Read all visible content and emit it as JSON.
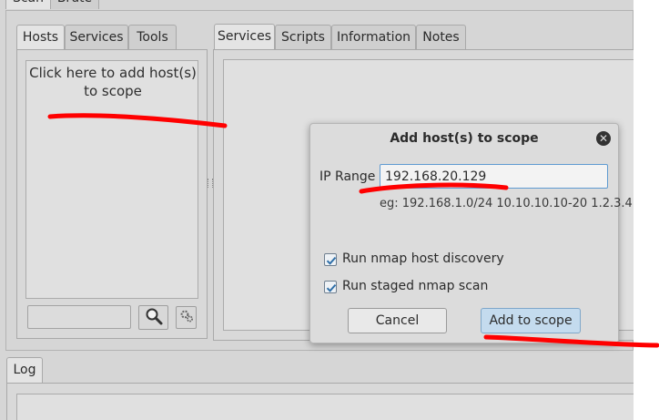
{
  "top_tabs": [
    "Scan",
    "Brute"
  ],
  "left_tabs": [
    "Hosts",
    "Services",
    "Tools"
  ],
  "right_tabs": [
    "Services",
    "Scripts",
    "Information",
    "Notes"
  ],
  "hosts_panel": {
    "hint": "Click here to add host(s) to scope",
    "filter_value": ""
  },
  "icons": {
    "search": "magnifier-icon",
    "settings": "gears-icon",
    "close": "close-icon",
    "check": "checkmark-icon"
  },
  "dialog": {
    "title": "Add host(s) to scope",
    "close_glyph": "✕",
    "ip_label": "IP Range",
    "ip_value": "192.168.20.129",
    "example": "eg: 192.168.1.0/24 10.10.10.10-20 1.2.3.4",
    "check_discovery": "Run nmap host discovery",
    "check_staged": "Run staged nmap scan",
    "discovery_checked": true,
    "staged_checked": true,
    "cancel": "Cancel",
    "add": "Add to scope"
  },
  "bottom_tabs": [
    "Log"
  ],
  "colors": {
    "annotation": "#ff0000",
    "accent": "#5f9bd1",
    "default_button": "#c4dbee"
  }
}
